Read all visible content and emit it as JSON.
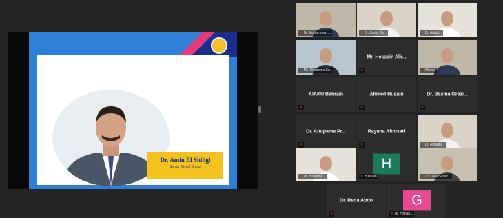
{
  "slide": {
    "speaker_name": "Dr. Amin El Shiligi",
    "speaker_title": "Senior Dental Doctor"
  },
  "participants": [
    {
      "label": "Dr. Mohammed ...",
      "video": true
    },
    {
      "label": "Dr. Carlin Ro...",
      "video": true
    },
    {
      "label": "Dr. Abdul...",
      "video": true
    },
    {
      "label": "Ms. Khadeeja Su...",
      "video": true
    },
    {
      "name": "Mr. Hessain Alk...",
      "video": false
    },
    {
      "label": "Ahmed",
      "video": true
    },
    {
      "name": "AlAKU Bahrain",
      "video": false
    },
    {
      "name": "Ahmed Husain",
      "video": false
    },
    {
      "name": "Dr. Basma Grazi...",
      "video": false
    },
    {
      "name": "Dr. Anupama Pr...",
      "video": false
    },
    {
      "name": "Rayana Aldosari",
      "video": false
    },
    {
      "label": "Dr. Alnaqbi...",
      "video": true
    },
    {
      "label": "Dr. Haleema...",
      "video": true
    },
    {
      "label": "Hussain",
      "avatar": "H",
      "avatar_color": "#1c7a5c"
    },
    {
      "label": "Dr. Laila Sahar...",
      "video": true
    },
    {
      "name": "Dr. Reda Abdo",
      "video": false
    },
    {
      "label": "Dr. Hanan...",
      "avatar": "G",
      "avatar_color": "#e64a92"
    }
  ],
  "colors": {
    "background": "#242424",
    "tile": "#2d2d2d",
    "active_speaker": "#9bd84a",
    "muted_mic": "#e13b3b"
  }
}
